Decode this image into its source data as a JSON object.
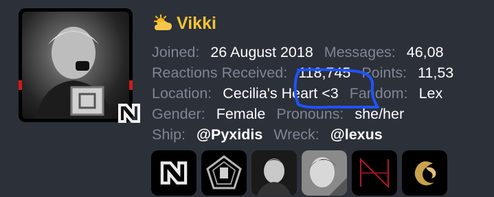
{
  "profile": {
    "username": "Vikki",
    "username_icon": "sun-behind-cloud-icon",
    "avatar": "profile-photo",
    "badge_icon": "superm-logo-icon"
  },
  "stats": {
    "joined_label": "Joined:",
    "joined_value": "26 August 2018",
    "messages_label": "Messages:",
    "messages_value": "46,08",
    "reactions_label": "Reactions Received:",
    "reactions_value": "118,745",
    "points_label": "Points:",
    "points_value": "11,53",
    "location_label": "Location:",
    "location_value_1": "Cecilia's",
    "location_value_2": "Heart <3",
    "fandom_label": "Fandom:",
    "fandom_value": "Lex",
    "gender_label": "Gender:",
    "gender_value": "Female",
    "pronouns_label": "Pronouns:",
    "pronouns_value": "she/her",
    "ship_label": "Ship:",
    "ship_value": "@Pyxidis",
    "wreck_label": "Wreck:",
    "wreck_value": "@lexus"
  },
  "trophies": [
    {
      "icon": "superm-logo-icon"
    },
    {
      "icon": "pentagon-logo-icon"
    },
    {
      "icon": "portrait-icon"
    },
    {
      "icon": "portrait-icon"
    },
    {
      "icon": "line-logo-icon"
    },
    {
      "icon": "gold-dragon-icon"
    }
  ],
  "colors": {
    "background": "#2c3039",
    "username": "#f3c433",
    "label": "#7f8594",
    "value": "#ffffff",
    "annotation": "#1e54ff"
  }
}
